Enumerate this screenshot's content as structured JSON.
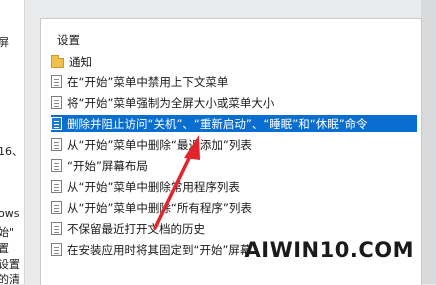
{
  "left_pane": {
    "fragments": [
      "屏",
      "",
      "",
      "",
      "16、",
      "",
      "ows",
      "始\"",
      "置",
      "设置",
      "的清"
    ]
  },
  "main": {
    "header": "设置",
    "folder": {
      "label": "通知",
      "icon": "folder-icon"
    },
    "policies": [
      {
        "label": "在“开始”菜单中禁用上下文菜单",
        "selected": false
      },
      {
        "label": "将“开始”菜单强制为全屏大小或菜单大小",
        "selected": false
      },
      {
        "label": "删除并阻止访问“关机”、“重新启动”、“睡眠”和“休眠”命令",
        "selected": true
      },
      {
        "label": "从“开始”菜单中删除“最近添加”列表",
        "selected": false
      },
      {
        "label": "“开始”屏幕布局",
        "selected": false
      },
      {
        "label": "从“开始”菜单中删除常用程序列表",
        "selected": false
      },
      {
        "label": "从“开始”菜单中删除“所有程序”列表",
        "selected": false
      },
      {
        "label": "不保留最近打开文档的历史",
        "selected": false
      },
      {
        "label": "在安装应用时将其固定到“开始”屏幕",
        "selected": false
      }
    ]
  },
  "annotation": {
    "color": "#e0262b",
    "icon": "red-arrow"
  },
  "watermark": "AIWIN10.COM",
  "colors": {
    "selection": "#0a6ed1",
    "folder": "#f0c14b"
  }
}
